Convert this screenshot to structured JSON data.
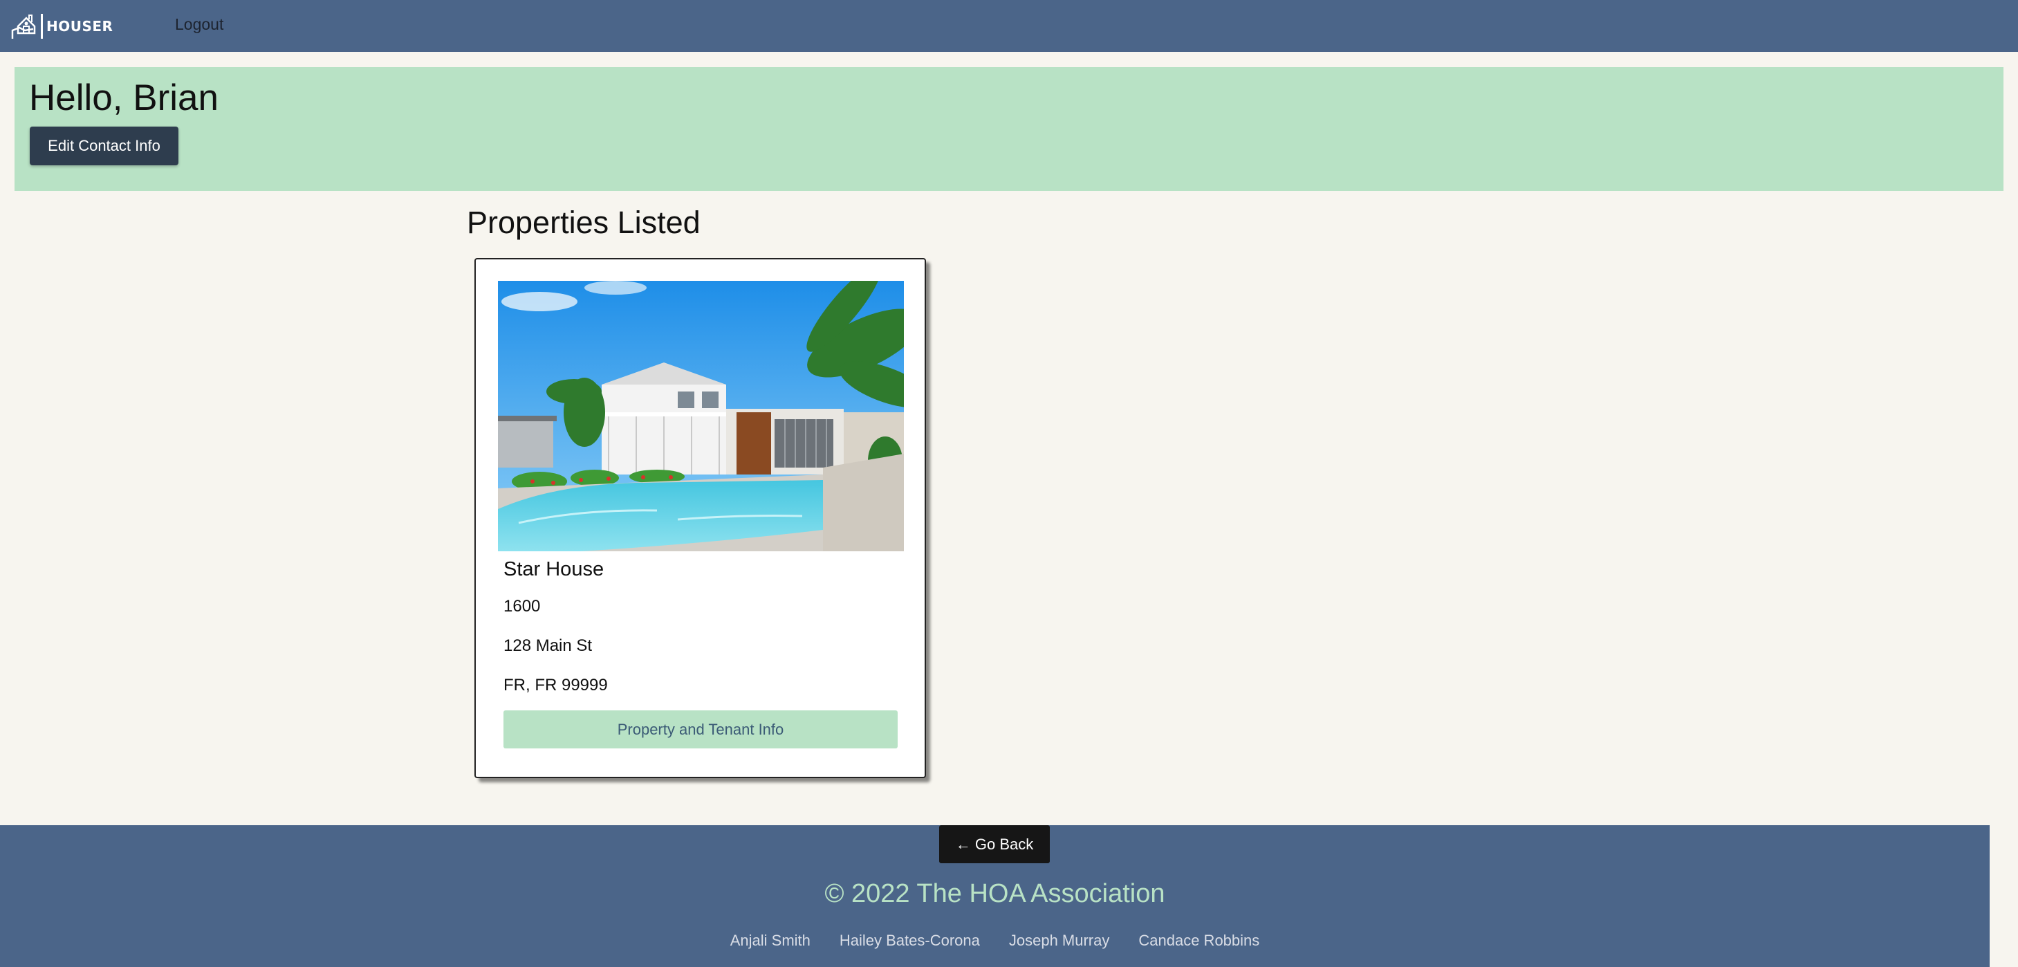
{
  "nav": {
    "logo_text": "HOUSER",
    "logout_label": "Logout"
  },
  "banner": {
    "greeting": "Hello, Brian",
    "edit_label": "Edit Contact Info"
  },
  "section": {
    "title": "Properties Listed"
  },
  "properties": [
    {
      "name": "Star House",
      "number": "1600",
      "street": "128 Main St",
      "city_state_zip": "FR, FR 99999",
      "button_label": "Property and Tenant Info"
    }
  ],
  "footer": {
    "go_back_label": "← Go Back",
    "copyright": "© 2022 The HOA Association",
    "authors": [
      "Anjali Smith",
      "Hailey Bates-Corona",
      "Joseph Murray",
      "Candace Robbins"
    ]
  },
  "colors": {
    "navbar": "#4b6589",
    "banner": "#b8e2c5",
    "page_bg": "#f7f5ef",
    "dark_button": "#2e3d4e"
  }
}
